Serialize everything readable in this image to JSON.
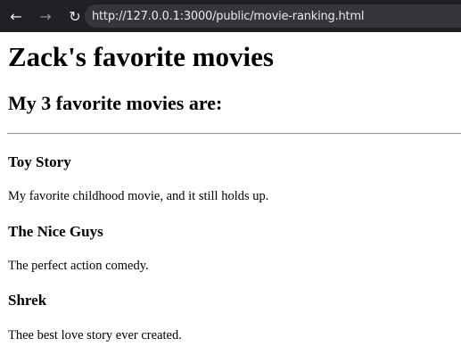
{
  "browser": {
    "back_icon": "back-arrow-icon",
    "back_glyph": "←",
    "forward_icon": "forward-arrow-icon",
    "forward_glyph": "→",
    "reload_icon": "reload-icon",
    "reload_glyph": "↻",
    "url": "http://127.0.0.1:3000/public/movie-ranking.html"
  },
  "page": {
    "title": "Zack's favorite movies",
    "subtitle": "My 3 favorite movies are:",
    "movies": [
      {
        "title": "Toy Story",
        "description": "My favorite childhood movie, and it still holds up."
      },
      {
        "title": "The Nice Guys",
        "description": "The perfect action comedy."
      },
      {
        "title": "Shrek",
        "description": "Thee best love story ever created."
      }
    ]
  }
}
